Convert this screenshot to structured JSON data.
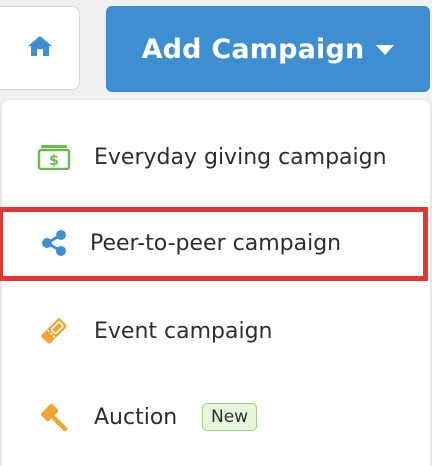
{
  "toolbar": {
    "home_icon": "home-icon",
    "add_campaign_label": "Add Campaign",
    "accent_color": "#3d8fd1"
  },
  "menu": {
    "items": [
      {
        "label": "Everyday giving campaign",
        "icon": "money-icon",
        "icon_color": "#6fb84a"
      },
      {
        "label": "Peer-to-peer campaign",
        "icon": "share-icon",
        "icon_color": "#3d8fd1",
        "highlighted": true
      },
      {
        "label": "Event campaign",
        "icon": "ticket-icon",
        "icon_color": "#f0a531"
      },
      {
        "label": "Auction",
        "icon": "gavel-icon",
        "icon_color": "#f0a531",
        "badge": "New"
      }
    ]
  },
  "highlight_color": "#e33535"
}
